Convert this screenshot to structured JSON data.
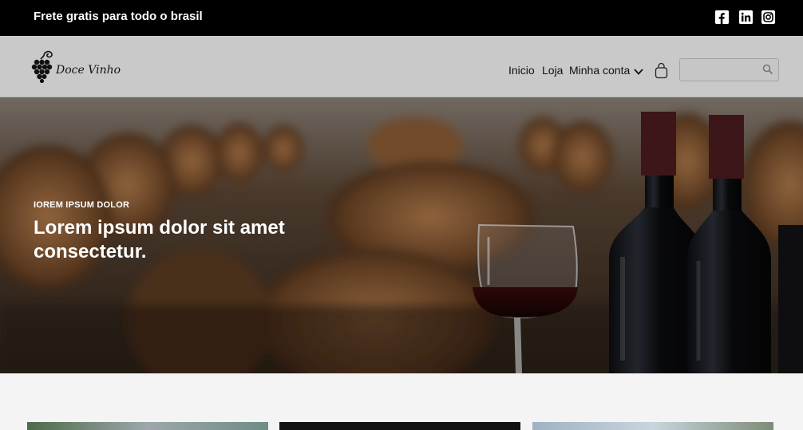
{
  "topbar": {
    "text": "Frete gratis para todo o brasil",
    "social": [
      "facebook-icon",
      "linkedin-icon",
      "instagram-icon"
    ]
  },
  "header": {
    "logo_text": "Doce Vinho",
    "nav": [
      "Inicio",
      "Loja",
      "Minha conta"
    ],
    "search_placeholder": ""
  },
  "hero": {
    "eyebrow": "IOREM IPSUM DOLOR",
    "headline": "Lorem ipsum dolor sit amet consectetur."
  },
  "colors": {
    "topbar": "#000000",
    "header": "#c9c9c9",
    "page": "#f4f4f4"
  }
}
